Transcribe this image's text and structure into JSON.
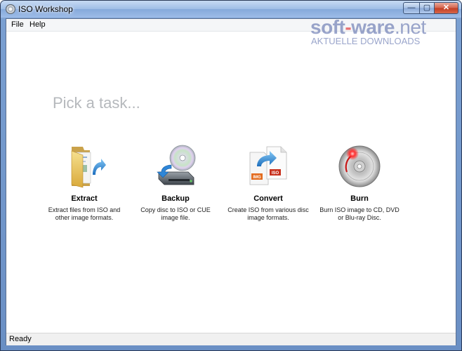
{
  "window": {
    "title": "ISO Workshop",
    "minimize": "—",
    "maximize": "▢",
    "close": "✕"
  },
  "menu": {
    "items": [
      "File",
      "Help"
    ]
  },
  "watermark": {
    "brand_a": "soft",
    "brand_dash": "-",
    "brand_b": "ware",
    "brand_c": ".net",
    "subtitle": "AKTUELLE DOWNLOADS"
  },
  "main": {
    "heading": "Pick a task..."
  },
  "tasks": [
    {
      "label": "Extract",
      "desc_1": "Extract files from ISO and",
      "desc_2": "other image formats.",
      "icon": "folder-arrow-icon"
    },
    {
      "label": "Backup",
      "desc_1": "Copy disc to ISO or CUE",
      "desc_2": "image file.",
      "icon": "disc-drive-icon"
    },
    {
      "label": "Convert",
      "desc_1": "Create ISO from various disc",
      "desc_2": "image formats.",
      "icon": "convert-files-icon"
    },
    {
      "label": "Burn",
      "desc_1": "Burn ISO image to CD, DVD",
      "desc_2": "or Blu-ray Disc.",
      "icon": "burn-disc-icon"
    }
  ],
  "convert_icon": {
    "tag_left": "IMG",
    "tag_right": "ISO"
  },
  "status": {
    "text": "Ready"
  }
}
